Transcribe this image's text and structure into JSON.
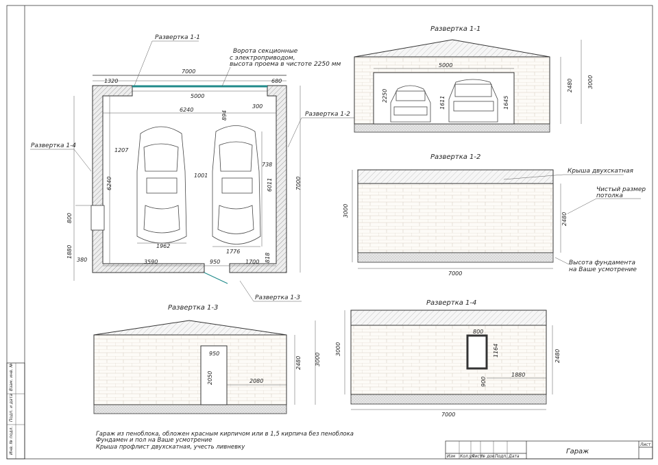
{
  "plan": {
    "labels": {
      "r11": "Развертка 1-1",
      "r12": "Развертка 1-2",
      "r13": "Развертка 1-3",
      "r14": "Развертка 1-4",
      "gate_note_1": "Ворота секционные",
      "gate_note_2": "с электроприводом,",
      "gate_note_3": "высота проема в чистоте 2250 мм"
    },
    "dims": {
      "top_7000": "7000",
      "top_1320": "1320",
      "top_680": "680",
      "gate_5000": "5000",
      "inner_6240": "6240",
      "d_300": "300",
      "d_894": "894",
      "d_1207": "1207",
      "d_1001": "1001",
      "d_738": "738",
      "d_6011": "6011",
      "left_6240": "6240",
      "right_7000": "7000",
      "d_800": "800",
      "d_1880": "1880",
      "d_380": "380",
      "d_1962": "1962",
      "d_1776": "1776",
      "d_3590": "3590",
      "d_950": "950",
      "d_1700": "1700",
      "d_818": "818"
    }
  },
  "elev11": {
    "title": "Развертка 1-1",
    "d_5000": "5000",
    "d_2250": "2250",
    "d_1611": "1611",
    "d_1645": "1645",
    "d_2480": "2480",
    "d_3000": "3000"
  },
  "elev12": {
    "title": "Развертка 1-2",
    "roof_note": "Крыша двухскатная",
    "ceiling_note_1": "Чистый размер",
    "ceiling_note_2": "потолка",
    "found_note_1": "Высота фундамента",
    "found_note_2": "на Ваше усмотрение",
    "d_3000": "3000",
    "d_2480": "2480",
    "d_7000": "7000"
  },
  "elev13": {
    "title": "Развертка 1-3",
    "d_950": "950",
    "d_2050": "2050",
    "d_2080": "2080",
    "d_2480": "2480",
    "d_3000": "3000"
  },
  "elev14": {
    "title": "Развертка 1-4",
    "d_800": "800",
    "d_1164": "1164",
    "d_900": "900",
    "d_1880": "1880",
    "d_3000": "3000",
    "d_2480": "2480",
    "d_7000": "7000"
  },
  "notes": {
    "line1": "Гараж из пеноблока, обложен красным кирпичом или в 1,5 кирпича без пеноблока",
    "line2": "Фундамен и пол на Ваше усмотрение",
    "line3": "Крыша профлист двухскатная, учесть ливневку"
  },
  "stamp": {
    "title": "Гараж",
    "sheet": "Лист",
    "cols": [
      "Изм",
      "Кол.уч",
      "Лист",
      "№ док.",
      "Подп.",
      "Дата"
    ],
    "side": [
      "Инв. № подл.",
      "Подп. и дата",
      "Взам. инв. №"
    ]
  }
}
